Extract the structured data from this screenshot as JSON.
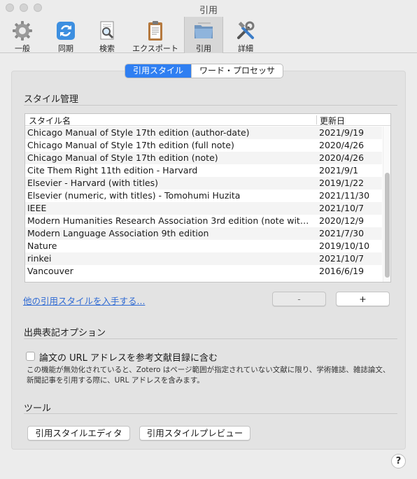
{
  "window": {
    "title": "引用"
  },
  "toolbar": {
    "items": [
      {
        "label": "一般",
        "icon": "gear-icon"
      },
      {
        "label": "同期",
        "icon": "sync-icon"
      },
      {
        "label": "検索",
        "icon": "search-document-icon"
      },
      {
        "label": "エクスポート",
        "icon": "clipboard-icon"
      },
      {
        "label": "引用",
        "icon": "folder-icon"
      },
      {
        "label": "詳細",
        "icon": "tools-icon"
      }
    ],
    "selected": "引用"
  },
  "tabs": [
    {
      "label": "引用スタイル",
      "active": true
    },
    {
      "label": "ワード・プロセッサ",
      "active": false
    }
  ],
  "style_manager": {
    "title": "スタイル管理",
    "columns": {
      "name": "スタイル名",
      "updated": "更新日"
    },
    "rows": [
      {
        "name": "Chicago Manual of Style 17th edition (author-date)",
        "date": "2021/9/19"
      },
      {
        "name": "Chicago Manual of Style 17th edition (full note)",
        "date": "2020/4/26"
      },
      {
        "name": "Chicago Manual of Style 17th edition (note)",
        "date": "2020/4/26"
      },
      {
        "name": "Cite Them Right 11th edition - Harvard",
        "date": "2021/9/1"
      },
      {
        "name": "Elsevier - Harvard (with titles)",
        "date": "2019/1/22"
      },
      {
        "name": "Elsevier (numeric, with titles) - Tomohumi Huzita",
        "date": "2021/11/30"
      },
      {
        "name": "IEEE",
        "date": "2021/10/7"
      },
      {
        "name": "Modern Humanities Research Association 3rd edition (note wit…",
        "date": "2020/12/9"
      },
      {
        "name": "Modern Language Association 9th edition",
        "date": "2021/7/30"
      },
      {
        "name": "Nature",
        "date": "2019/10/10"
      },
      {
        "name": "rinkei",
        "date": "2021/10/7"
      },
      {
        "name": "Vancouver",
        "date": "2016/6/19"
      }
    ],
    "get_more_link": "他の引用スタイルを入手する...",
    "remove_label": "-",
    "add_label": "+"
  },
  "citation_options": {
    "title": "出典表記オプション",
    "include_url_label": "論文の URL アドレスを参考文献目録に含む",
    "include_url_checked": false,
    "description": "この機能が無効化されていると、Zotero はページ範囲が指定されていない文献に限り、学術雑誌、雑誌論文、新聞記事を引用する際に、URL アドレスを含みます。"
  },
  "tools": {
    "title": "ツール",
    "style_editor_label": "引用スタイルエディタ",
    "style_preview_label": "引用スタイルプレビュー"
  },
  "help": {
    "label": "?"
  },
  "colors": {
    "accent": "#2f7ff2",
    "link": "#2f6ad3"
  }
}
